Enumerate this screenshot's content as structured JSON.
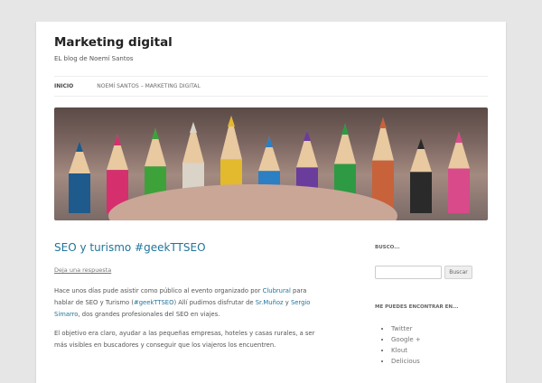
{
  "site": {
    "title": "Marketing digital",
    "tagline": "EL blog de Noemí Santos"
  },
  "nav": [
    {
      "label": "Inicio"
    },
    {
      "label": "Noemí Santos – Marketing Digital"
    }
  ],
  "hero": {
    "pencil_colors": [
      "#1e5b8c",
      "#d62f6e",
      "#3da23a",
      "#d9d3c8",
      "#e3b92e",
      "#2c7fc2",
      "#6a3c9c",
      "#2e9a44",
      "#c8623a",
      "#2a2a2a",
      "#d84a8a"
    ]
  },
  "post": {
    "title": "SEO y turismo #geekTTSEO",
    "reply": "Deja una respuesta",
    "p1": {
      "t1": "Hace unos días pude asistir como público al evento organizado por ",
      "l1": "Clubrural",
      "t2": " para hablar de SEO y Turismo (",
      "l2": "#geekTTSEO",
      "t3": ")  Allí pudimos disfrutar de ",
      "l3": "Sr.Muñoz",
      "t4": " y ",
      "l4": "Sergio Simarro",
      "t5": ", dos grandes profesionales del SEO en viajes."
    },
    "p2": "El objetivo era claro, ayudar a las pequeñas empresas, hoteles y casas rurales, a ser más visibles en buscadores y conseguir que los viajeros los encuentren."
  },
  "sidebar": {
    "search_title": "Busco...",
    "search_button": "Buscar",
    "search_value": "",
    "find_title": "Me puedes encontrar en...",
    "links": [
      "Twitter",
      "Google +",
      "Klout",
      "Delicious"
    ]
  }
}
